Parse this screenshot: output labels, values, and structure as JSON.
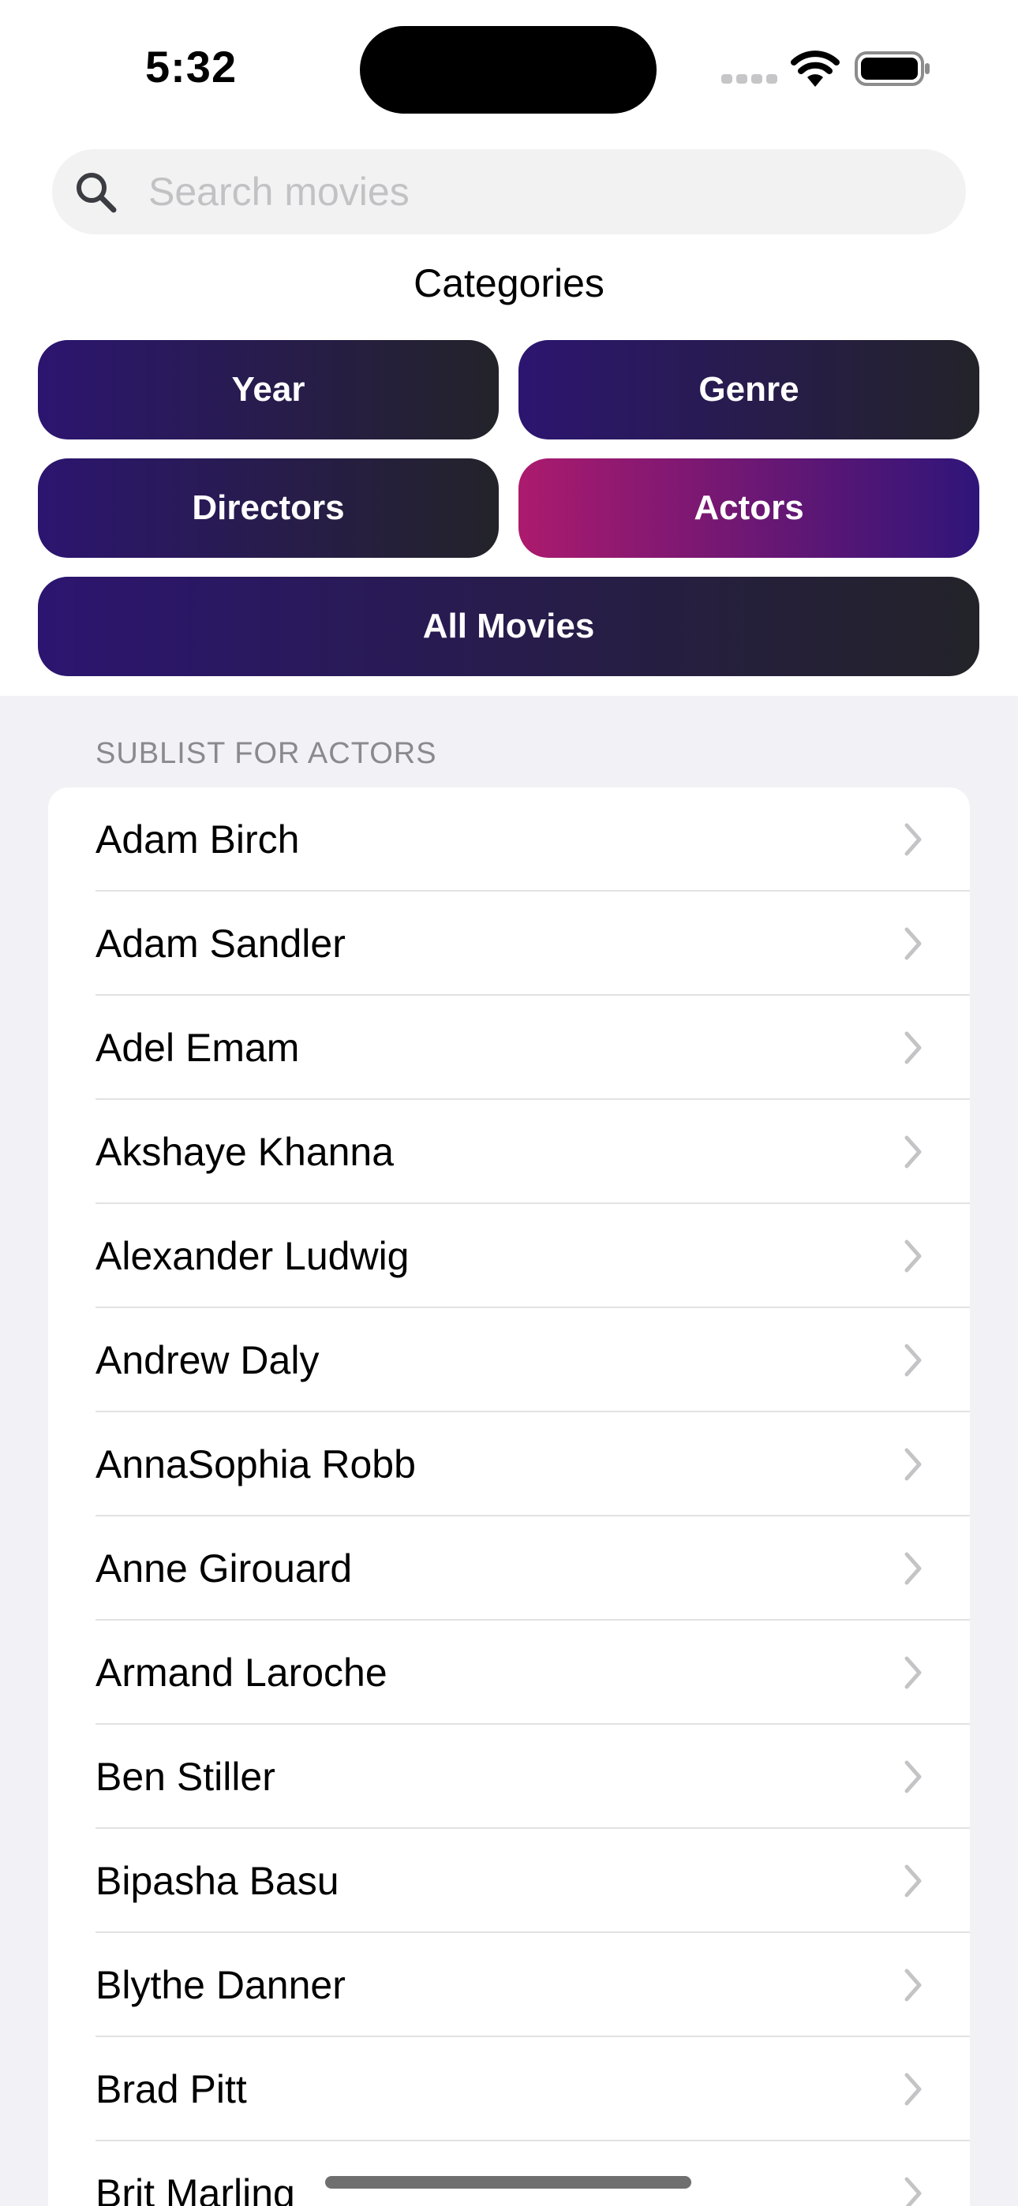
{
  "status_bar": {
    "time": "5:32"
  },
  "search": {
    "placeholder": "Search movies",
    "value": ""
  },
  "categories": {
    "title": "Categories",
    "year": "Year",
    "genre": "Genre",
    "directors": "Directors",
    "actors": "Actors",
    "all_movies": "All Movies",
    "selected": "Actors"
  },
  "sublist": {
    "header": "SUBLIST FOR ACTORS",
    "items": [
      "Adam Birch",
      "Adam Sandler",
      "Adel Emam",
      "Akshaye Khanna",
      "Alexander Ludwig",
      "Andrew Daly",
      "AnnaSophia Robb",
      "Anne Girouard",
      "Armand Laroche",
      "Ben Stiller",
      "Bipasha Basu",
      "Blythe Danner",
      "Brad Pitt",
      "Brit Marling"
    ]
  },
  "colors": {
    "button_gradient": [
      "#2c1570",
      "#232329"
    ],
    "active_gradient": [
      "#ac1a6e",
      "#2f1579"
    ],
    "grouped_background": "#f1f1f6"
  },
  "icons": {
    "search": "search-icon",
    "chevron": "chevron-right-icon",
    "wifi": "wifi-icon",
    "battery": "battery-icon"
  }
}
